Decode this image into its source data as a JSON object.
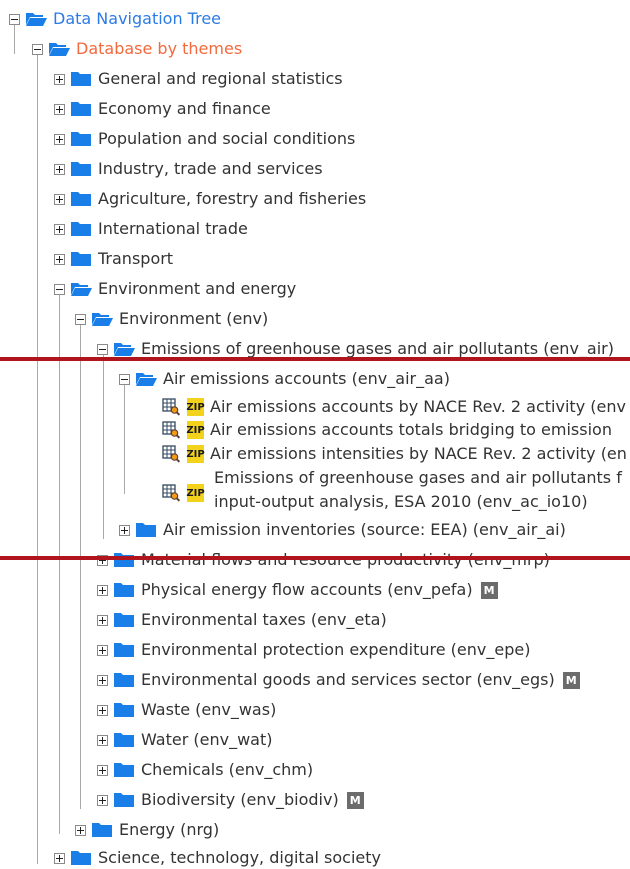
{
  "tree": {
    "root": {
      "label": "Data Navigation Tree"
    },
    "themes": {
      "label": "Database by themes"
    },
    "level1": [
      {
        "label": "General and regional statistics"
      },
      {
        "label": "Economy and finance"
      },
      {
        "label": "Population and social conditions"
      },
      {
        "label": "Industry, trade and services"
      },
      {
        "label": "Agriculture, forestry and fisheries"
      },
      {
        "label": "International trade"
      },
      {
        "label": "Transport"
      },
      {
        "label": "Environment and energy"
      }
    ],
    "environment": {
      "label": "Environment (env)"
    },
    "emissions": {
      "label": "Emissions of greenhouse gases and air pollutants (env_air)"
    },
    "air_accounts": {
      "label": "Air emissions accounts (env_air_aa)"
    },
    "datasets": [
      {
        "label": "Air emissions accounts by NACE Rev. 2 activity (env"
      },
      {
        "label": "Air emissions accounts totals bridging to emission"
      },
      {
        "label": "Air emissions intensities by NACE Rev. 2 activity (en"
      },
      {
        "label_line1": "Emissions of greenhouse gases and air pollutants f",
        "label_line2": "input-output analysis, ESA 2010 (env_ac_io10)"
      }
    ],
    "zip_label": "ZIP",
    "meta_label": "M",
    "inventories": {
      "label": "Air emission inventories (source: EEA) (env_air_ai)"
    },
    "env_children": [
      {
        "label": "Material flows and resource productivity (env_mrp)"
      },
      {
        "label": "Physical energy flow accounts (env_pefa)"
      },
      {
        "label": "Environmental taxes (env_eta)"
      },
      {
        "label": "Environmental protection expenditure (env_epe)"
      },
      {
        "label": "Environmental goods and services sector (env_egs)"
      },
      {
        "label": "Waste (env_was)"
      },
      {
        "label": "Water (env_wat)"
      },
      {
        "label": "Chemicals (env_chm)"
      },
      {
        "label": "Biodiversity (env_biodiv)"
      }
    ],
    "energy": {
      "label": "Energy (nrg)"
    },
    "science": {
      "label": "Science, technology, digital society"
    }
  },
  "colors": {
    "folder": "#1a7ee8",
    "link": "#2c7be5",
    "orange": "#f26a3d",
    "highlight_bar": "#b0151d",
    "zip": "#f3d21b"
  },
  "icons": {
    "closed_folder": "folder-icon",
    "open_folder": "folder-open-icon",
    "dataset": "table-search-icon",
    "metadata": "metadata-icon"
  }
}
